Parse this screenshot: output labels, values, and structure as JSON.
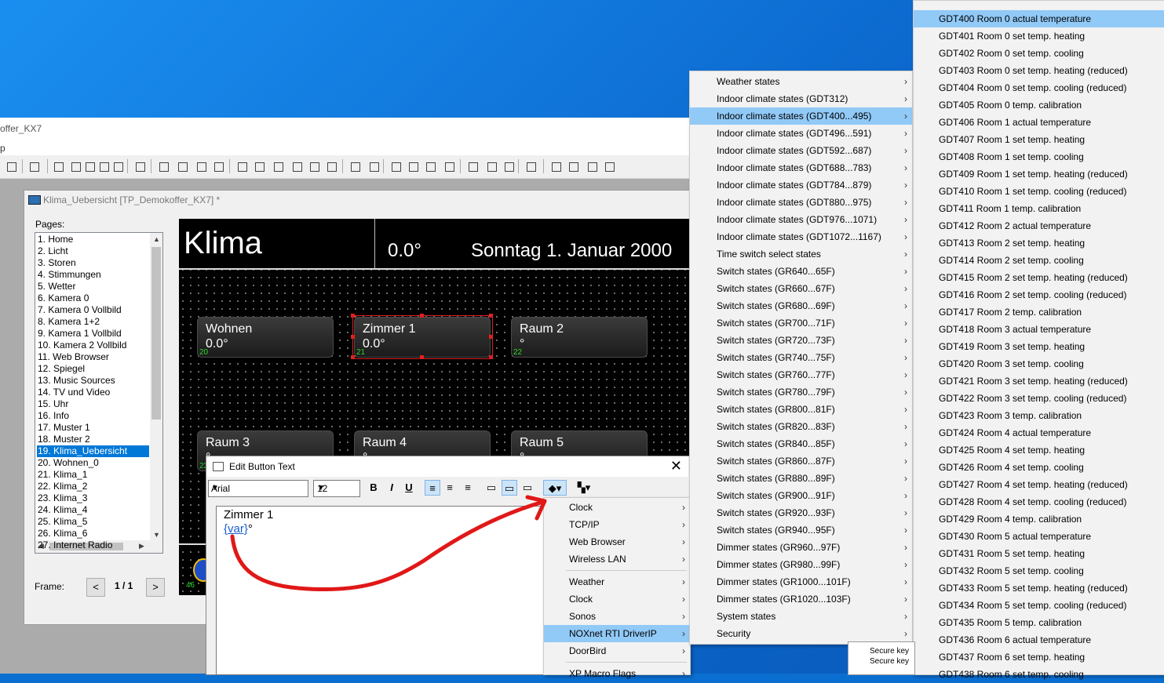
{
  "app": {
    "title_fragment": "offer_KX7",
    "menu_fragment": "p"
  },
  "document": {
    "title": "Klima_Uebersicht [TP_Demokoffer_KX7] *"
  },
  "pages_label": "Pages:",
  "pages": [
    "1. Home",
    "2. Licht",
    "3. Storen",
    "4. Stimmungen",
    "5. Wetter",
    "6. Kamera 0",
    "7. Kamera 0 Vollbild",
    "8. Kamera 1+2",
    "9. Kamera 1 Vollbild",
    "10. Kamera 2 Vollbild",
    "11. Web Browser",
    "12. Spiegel",
    "13. Music Sources",
    "14. TV und Video",
    "15. Uhr",
    "16. Info",
    "17. Muster 1",
    "18. Muster 2",
    "19. Klima_Uebersicht",
    "20. Wohnen_0",
    "21. Klima_1",
    "22. Klima_2",
    "23. Klima_3",
    "24. Klima_4",
    "25. Klima_5",
    "26. Klima_6",
    "27. Internet Radio"
  ],
  "selected_page_index": 18,
  "frame": {
    "label": "Frame:",
    "value": "1 / 1",
    "prev": "<",
    "next": ">"
  },
  "canvas": {
    "title": "Klima",
    "temp": "0.0°",
    "date": "Sonntag 1. Januar 2000",
    "widgets": [
      {
        "name": "Wohnen",
        "value": "0.0°",
        "id": "20"
      },
      {
        "name": "Zimmer 1",
        "value": "0.0°",
        "id": "21"
      },
      {
        "name": "Raum 2",
        "value": "°",
        "id": "22"
      },
      {
        "name": "Raum 3",
        "value": "°",
        "id": "23"
      },
      {
        "name": "Raum 4",
        "value": "°",
        "id": ""
      },
      {
        "name": "Raum 5",
        "value": "°",
        "id": ""
      }
    ],
    "bottom_id": "46"
  },
  "dialog": {
    "title": "Edit Button Text",
    "close": "✕",
    "font": "Arial",
    "size": "12",
    "bold": "B",
    "italic": "I",
    "underline": "U",
    "line1": "Zimmer 1",
    "var_token": "{var}",
    "var_suffix": "°"
  },
  "menu1": {
    "items": [
      "Clock",
      "TCP/IP",
      "Web Browser",
      "Wireless LAN",
      "Weather",
      "Clock",
      "Sonos",
      "NOXnet RTI DriverIP",
      "DoorBird",
      "XP Macro Flags"
    ],
    "highlighted_index": 7
  },
  "menu2": {
    "items": [
      "Weather states",
      "Indoor climate states (GDT312)",
      "Indoor climate states (GDT400...495)",
      "Indoor climate states (GDT496...591)",
      "Indoor climate states (GDT592...687)",
      "Indoor climate states (GDT688...783)",
      "Indoor climate states (GDT784...879)",
      "Indoor climate states (GDT880...975)",
      "Indoor climate states (GDT976...1071)",
      "Indoor climate states (GDT1072...1167)",
      "Time switch select states",
      "Switch states (GR640...65F)",
      "Switch states (GR660...67F)",
      "Switch states (GR680...69F)",
      "Switch states (GR700...71F)",
      "Switch states (GR720...73F)",
      "Switch states (GR740...75F)",
      "Switch states (GR760...77F)",
      "Switch states (GR780...79F)",
      "Switch states (GR800...81F)",
      "Switch states (GR820...83F)",
      "Switch states (GR840...85F)",
      "Switch states (GR860...87F)",
      "Switch states (GR880...89F)",
      "Switch states (GR900...91F)",
      "Switch states (GR920...93F)",
      "Switch states (GR940...95F)",
      "Dimmer states (GR960...97F)",
      "Dimmer states (GR980...99F)",
      "Dimmer states (GR1000...101F)",
      "Dimmer states (GR1020...103F)",
      "System states",
      "Security"
    ],
    "highlighted_index": 2
  },
  "menu3": {
    "items": [
      "GDT400 Room 0 actual temperature",
      "GDT401 Room 0 set temp. heating",
      "GDT402 Room 0 set temp. cooling",
      "GDT403 Room 0 set temp. heating (reduced)",
      "GDT404 Room 0 set temp. cooling (reduced)",
      "GDT405 Room 0 temp. calibration",
      "GDT406 Room 1 actual temperature",
      "GDT407 Room 1 set temp. heating",
      "GDT408 Room 1 set temp. cooling",
      "GDT409 Room 1 set temp. heating (reduced)",
      "GDT410 Room 1 set temp. cooling (reduced)",
      "GDT411 Room 1 temp. calibration",
      "GDT412 Room 2 actual temperature",
      "GDT413 Room 2 set temp. heating",
      "GDT414 Room 2 set temp. cooling",
      "GDT415 Room 2 set temp. heating (reduced)",
      "GDT416 Room 2 set temp. cooling (reduced)",
      "GDT417 Room 2 temp. calibration",
      "GDT418 Room 3 actual temperature",
      "GDT419 Room 3 set temp. heating",
      "GDT420 Room 3 set temp. cooling",
      "GDT421 Room 3 set temp. heating (reduced)",
      "GDT422 Room 3 set temp. cooling (reduced)",
      "GDT423 Room 3 temp. calibration",
      "GDT424 Room 4 actual temperature",
      "GDT425 Room 4 set temp. heating",
      "GDT426 Room 4 set temp. cooling",
      "GDT427 Room 4 set temp. heating (reduced)",
      "GDT428 Room 4 set temp. cooling (reduced)",
      "GDT429 Room 4 temp. calibration",
      "GDT430 Room 5 actual temperature",
      "GDT431 Room 5 set temp. heating",
      "GDT432 Room 5 set temp. cooling",
      "GDT433 Room 5 set temp. heating (reduced)",
      "GDT434 Room 5 set temp. cooling (reduced)",
      "GDT435 Room 5 temp. calibration",
      "GDT436 Room 6 actual temperature",
      "GDT437 Room 6 set temp. heating",
      "GDT438 Room 6 set temp. cooling"
    ],
    "highlighted_index": 0
  },
  "right_panel": {
    "line1": "Secure key",
    "line2": "Secure key"
  },
  "colors": {
    "highlight": "#91c9f7",
    "selection": "#0078d7",
    "annotation": "#e01818",
    "widget_id": "#29d629"
  }
}
